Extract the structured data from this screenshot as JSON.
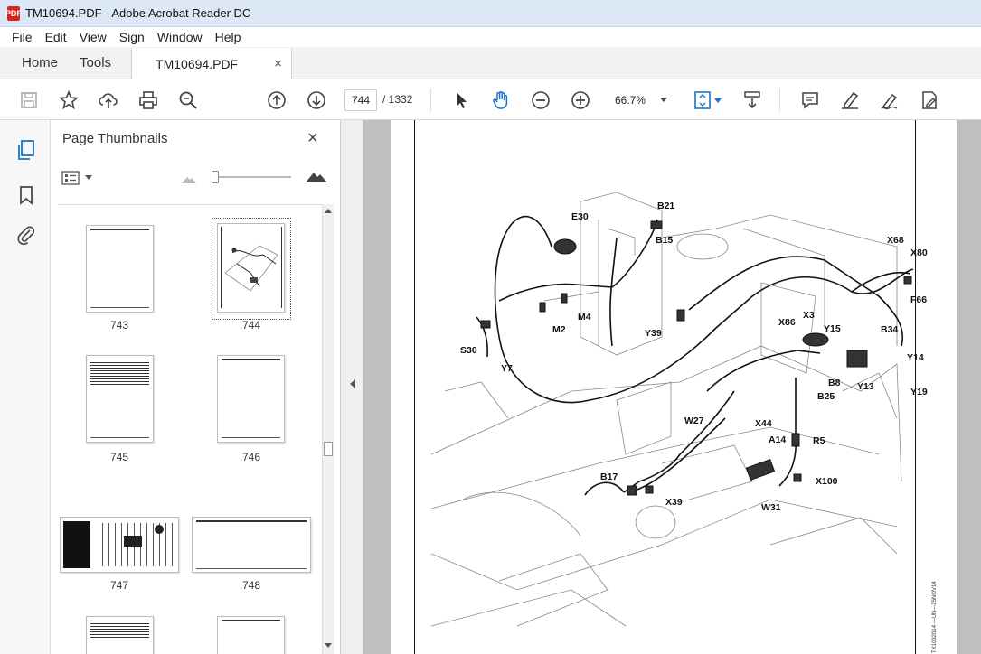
{
  "window": {
    "title": "TM10694.PDF - Adobe Acrobat Reader DC",
    "app_badge": "PDF"
  },
  "menu": [
    "File",
    "Edit",
    "View",
    "Sign",
    "Window",
    "Help"
  ],
  "tabs": {
    "home": "Home",
    "tools": "Tools",
    "document": "TM10694.PDF",
    "close_glyph": "×"
  },
  "toolbar": {
    "current_page": "744",
    "total_pages": "/ 1332",
    "zoom": "66.7%",
    "icons": [
      "save-icon",
      "bookmark-star-icon",
      "upload-cloud-icon",
      "print-icon",
      "find-zoom-icon",
      "prev-page-icon",
      "next-page-icon",
      "select-arrow-icon",
      "hand-icon",
      "zoom-out-icon",
      "zoom-in-icon",
      "fit-page-icon",
      "scroll-mode-icon",
      "comment-icon",
      "highlight-icon",
      "sign-icon",
      "edit-pdf-icon"
    ]
  },
  "sidebar": {
    "title": "Page Thumbnails",
    "close_glyph": "×",
    "thumbnails": [
      {
        "label": "743",
        "selected": false
      },
      {
        "label": "744",
        "selected": true
      },
      {
        "label": "745",
        "selected": false
      },
      {
        "label": "746",
        "selected": false
      },
      {
        "label": "747",
        "selected": false
      },
      {
        "label": "748",
        "selected": false
      }
    ]
  },
  "diagram": {
    "labels": [
      "E30",
      "B21",
      "B15",
      "X68",
      "X80",
      "F66",
      "S30",
      "Y7",
      "M2",
      "M4",
      "Y39",
      "X3",
      "X86",
      "Y15",
      "B34",
      "Y14",
      "B8",
      "Y13",
      "B25",
      "Y19",
      "W27",
      "X44",
      "A14",
      "R5",
      "B17",
      "X39",
      "X100",
      "W31"
    ],
    "side_code": "TX1032014 —UN—25NOV14"
  },
  "colors": {
    "titlebar": "#dce8f6",
    "accent_blue": "#1a73c8",
    "pdf_red": "#d9261c",
    "doc_background": "#bfbfbf"
  }
}
